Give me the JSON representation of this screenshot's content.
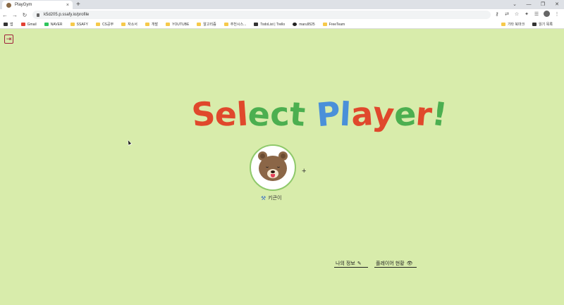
{
  "browser": {
    "tab_title": "PlayGym",
    "tab_close": "×",
    "new_tab": "+",
    "url": "k5d205.p.ssafy.io/profile",
    "window_buttons": [
      "⌄",
      "—",
      "❐",
      "✕"
    ],
    "nav": {
      "back": "←",
      "forward": "→",
      "reload": "↻"
    },
    "bookmarks": [
      {
        "label": "앱",
        "icon": "apps-icon"
      },
      {
        "label": "Gmail",
        "icon": "gmail-icon"
      },
      {
        "label": "NAVER",
        "icon": "naver-icon"
      },
      {
        "label": "SSAFY",
        "icon": "folder-icon"
      },
      {
        "label": "CS공부",
        "icon": "folder-icon"
      },
      {
        "label": "자소서",
        "icon": "folder-icon"
      },
      {
        "label": "개발",
        "icon": "folder-icon"
      },
      {
        "label": "YOUTUBE",
        "icon": "folder-icon"
      },
      {
        "label": "알고리즘",
        "icon": "folder-icon"
      },
      {
        "label": "추천시스...",
        "icon": "folder-icon"
      },
      {
        "label": "TodoList | Trello",
        "icon": "trello-icon"
      },
      {
        "label": "maru9525",
        "icon": "github-icon"
      },
      {
        "label": "FreeTeam",
        "icon": "folder-icon"
      }
    ],
    "bookmarks_right": [
      "기타 북마크",
      "읽기 목록"
    ]
  },
  "page": {
    "title_letters": [
      {
        "ch": "S",
        "color": "#e0482c"
      },
      {
        "ch": "e",
        "color": "#e0482c"
      },
      {
        "ch": "l",
        "color": "#e0482c"
      },
      {
        "ch": "e",
        "color": "#4caf50"
      },
      {
        "ch": "c",
        "color": "#4caf50"
      },
      {
        "ch": "t",
        "color": "#4caf50"
      },
      {
        "ch": " ",
        "color": "#000000"
      },
      {
        "ch": "P",
        "color": "#4a90d9"
      },
      {
        "ch": "l",
        "color": "#4a90d9"
      },
      {
        "ch": "a",
        "color": "#e0482c"
      },
      {
        "ch": "y",
        "color": "#e0482c"
      },
      {
        "ch": "e",
        "color": "#4caf50"
      },
      {
        "ch": "r",
        "color": "#e0482c"
      },
      {
        "ch": "!",
        "color": "#4caf50"
      }
    ],
    "profile": {
      "name": "키큰이",
      "role_icon": "hammer-icon"
    },
    "add_profile": "+",
    "links": {
      "my_info": "나의 정보",
      "my_info_icon": "✎",
      "status": "플레이어 현황",
      "status_icon": "👁"
    },
    "logout_icon": "⇥"
  }
}
